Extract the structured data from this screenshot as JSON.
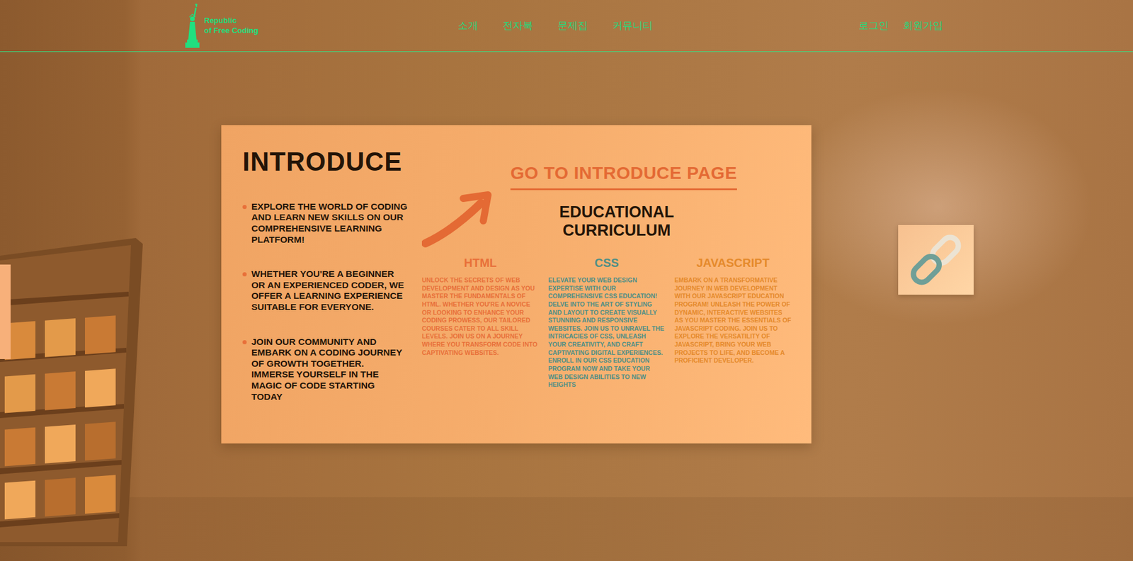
{
  "navbar": {
    "logo": {
      "line1": "Republic",
      "line2": "of Free Coding"
    },
    "menu": [
      "소개",
      "전자북",
      "문제집",
      "커뮤니티"
    ],
    "auth": [
      "로그인",
      "회원가입"
    ]
  },
  "poster": {
    "title": "INTRODUCE",
    "bullets": [
      "EXPLORE THE WORLD OF CODING AND LEARN NEW SKILLS ON OUR COMPREHENSIVE LEARNING PLATFORM!",
      "WHETHER YOU'RE A BEGINNER OR AN EXPERIENCED CODER, WE OFFER A LEARNING EXPERIENCE SUITABLE FOR EVERYONE.",
      "JOIN OUR COMMUNITY AND EMBARK ON A CODING JOURNEY OF GROWTH TOGETHER. IMMERSE YOURSELF IN THE MAGIC OF CODE STARTING TODAY"
    ],
    "link": "GO TO INTRODUCE PAGE",
    "curriculum_title": "EDUCATIONAL CURRICULUM",
    "courses": [
      {
        "name": "HTML",
        "color": "#e8703a",
        "description": "UNLOCK THE SECRETS OF WEB DEVELOPMENT AND DESIGN AS YOU MASTER THE FUNDAMENTALS OF HTML. WHETHER YOU'RE A NOVICE OR LOOKING TO ENHANCE YOUR CODING PROWESS, OUR TAILORED COURSES CATER TO ALL SKILL LEVELS. JOIN US ON A JOURNEY WHERE YOU TRANSFORM CODE INTO CAPTIVATING WEBSITES."
      },
      {
        "name": "CSS",
        "color": "#4f8f86",
        "description": "ELEVATE YOUR WEB DESIGN EXPERTISE WITH OUR COMPREHENSIVE CSS EDUCATION! DELVE INTO THE ART OF STYLING AND LAYOUT TO CREATE VISUALLY STUNNING AND RESPONSIVE WEBSITES. JOIN US TO UNRAVEL THE INTRICACIES OF CSS, UNLEASH YOUR CREATIVITY, AND CRAFT CAPTIVATING DIGITAL EXPERIENCES. ENROLL IN OUR CSS EDUCATION PROGRAM NOW AND TAKE YOUR WEB DESIGN ABILITIES TO NEW HEIGHTS"
      },
      {
        "name": "JAVASCRIPT",
        "color": "#e58a2c",
        "description": "EMBARK ON A TRANSFORMATIVE JOURNEY IN WEB DEVELOPMENT WITH OUR JAVASCRIPT EDUCATION PROGRAM! UNLEASH THE POWER OF DYNAMIC, INTERACTIVE WEBSITES AS YOU MASTER THE ESSENTIALS OF JAVASCRIPT CODING. JOIN US TO EXPLORE THE VERSATILITY OF JAVASCRIPT, BRING YOUR WEB PROJECTS TO LIFE, AND BECOME A PROFICIENT DEVELOPER."
      }
    ]
  }
}
